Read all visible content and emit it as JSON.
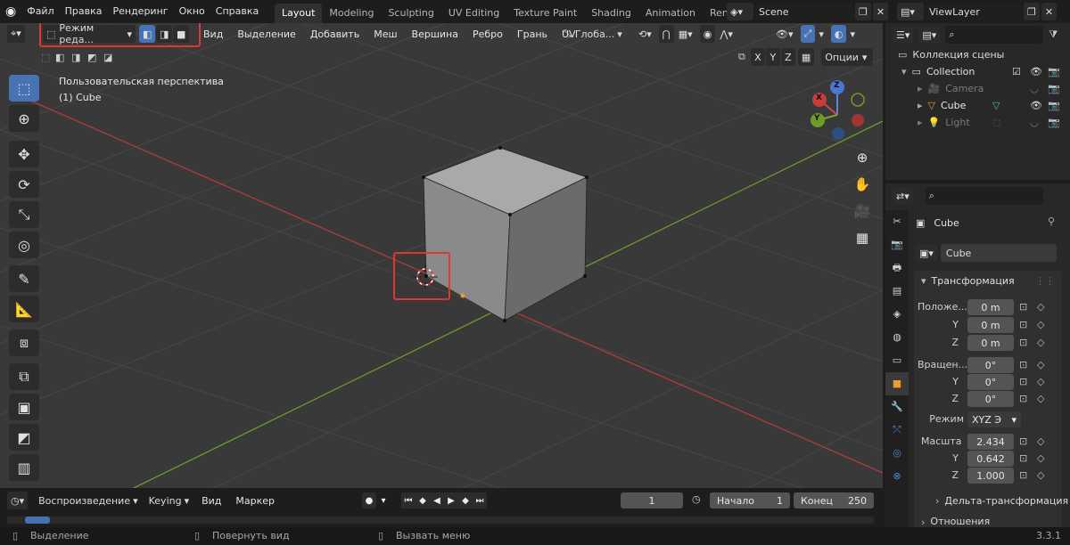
{
  "topbar": {
    "menus": [
      "Файл",
      "Правка",
      "Рендеринг",
      "Окно",
      "Справка"
    ],
    "workspaces": [
      "Layout",
      "Modeling",
      "Sculpting",
      "UV Editing",
      "Texture Paint",
      "Shading",
      "Animation",
      "Render"
    ],
    "active_workspace": "Layout",
    "scene": "Scene",
    "view_layer": "ViewLayer"
  },
  "viewport": {
    "mode_label": "Режим реда...",
    "menus": [
      "Вид",
      "Выделение",
      "Добавить",
      "Меш",
      "Вершина",
      "Ребро",
      "Грань",
      "UV"
    ],
    "transform_orientation": "Глоба...",
    "options_label": "Опции",
    "axes": [
      "X",
      "Y",
      "Z"
    ],
    "overlay_title": "Пользовательская перспектива",
    "overlay_object": "(1) Cube",
    "gizmo_labels": [
      "X",
      "Y",
      "Z"
    ]
  },
  "outliner": {
    "root": "Коллекция сцены",
    "items": [
      "Collection",
      "Camera",
      "Cube",
      "Light"
    ]
  },
  "properties": {
    "object_name": "Cube",
    "object_field": "Cube",
    "section": "Трансформация",
    "location_label": "Положе...",
    "rotation_label": "Вращен...",
    "mode_label": "Режим",
    "scale_label": "Масшта",
    "y_label": "Y",
    "z_label": "Z",
    "location": [
      "0 m",
      "0 m",
      "0 m"
    ],
    "rotation": [
      "0°",
      "0°",
      "0°"
    ],
    "rotation_mode": "XYZ Э",
    "scale": [
      "2.434",
      "0.642",
      "1.000"
    ],
    "delta": "Дельта-трансформация",
    "relations": "Отношения"
  },
  "timeline": {
    "playback": "Воспроизведение",
    "keying": "Keying",
    "view": "Вид",
    "marker": "Маркер",
    "current_frame": "1",
    "start_label": "Начало",
    "start": "1",
    "end_label": "Конец",
    "end": "250"
  },
  "status": {
    "select": "Выделение",
    "rotate": "Повернуть вид",
    "menu": "Вызвать меню",
    "version": "3.3.1"
  },
  "colors": {
    "accent": "#4772b3",
    "highlight": "#e0382e",
    "x_axis": "#d23c3c",
    "y_axis": "#7aa52b"
  }
}
